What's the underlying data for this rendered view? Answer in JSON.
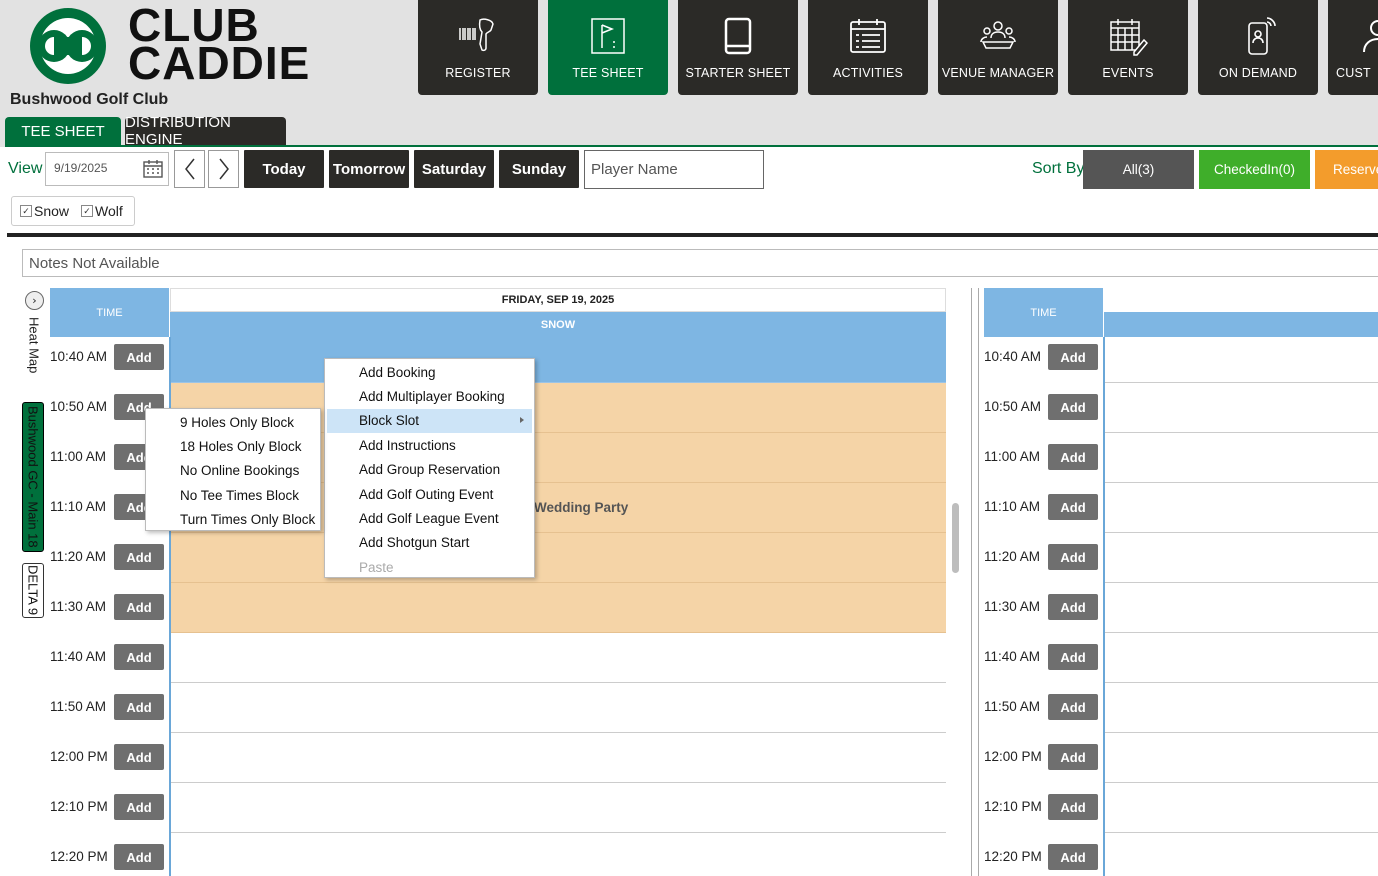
{
  "brand": {
    "logo_line1": "CLUB",
    "logo_line2": "CADDIE",
    "club_name": "Bushwood Golf Club",
    "primary_color": "#00703c",
    "dark_color": "#2b2a27"
  },
  "nav": [
    {
      "label": "REGISTER",
      "icon": "barcode-scanner-icon"
    },
    {
      "label": "TEE SHEET",
      "icon": "flag-icon",
      "active": true
    },
    {
      "label": "STARTER SHEET",
      "icon": "tablet-icon"
    },
    {
      "label": "ACTIVITIES",
      "icon": "calendar-list-icon"
    },
    {
      "label": "VENUE MANAGER",
      "icon": "group-table-icon"
    },
    {
      "label": "EVENTS",
      "icon": "calendar-edit-icon"
    },
    {
      "label": "ON DEMAND",
      "icon": "mobile-order-icon"
    },
    {
      "label": "CUST",
      "icon": "person-icon"
    }
  ],
  "subtabs": {
    "tee_sheet": "TEE SHEET",
    "distribution": "DISTRIBUTION ENGINE"
  },
  "toolbar": {
    "view_label": "View",
    "date_value": "9/19/2025",
    "quick_days": [
      "Today",
      "Tomorrow",
      "Saturday",
      "Sunday"
    ],
    "player_placeholder": "Player Name",
    "sort_label": "Sort By",
    "sort_buttons": [
      {
        "label": "All(3)",
        "color": "#555555"
      },
      {
        "label": "CheckedIn(0)",
        "color": "#3fae2a"
      },
      {
        "label": "Reserve",
        "color": "#f39c2c"
      }
    ]
  },
  "courses_filter": [
    {
      "label": "Snow",
      "checked": true
    },
    {
      "label": "Wolf",
      "checked": true
    }
  ],
  "notes": "Notes Not Available",
  "side_tabs": {
    "heat_map": "Heat Map",
    "course_main": "Bushwood GC - Main 18",
    "course_delta": "DELTA 9"
  },
  "sheet": {
    "time_header": "TIME",
    "day_title": "FRIDAY, SEP 19, 2025",
    "course_snow": "SNOW",
    "add_label": "Add",
    "block_label": "Wedding Party",
    "times": [
      "10:40 AM",
      "10:50 AM",
      "11:00 AM",
      "11:10 AM",
      "11:20 AM",
      "11:30 AM",
      "11:40 AM",
      "11:50 AM",
      "12:00 PM",
      "12:10 PM",
      "12:20 PM"
    ],
    "booked_color": "#7eb6e3",
    "block_color": "#f5d4a7"
  },
  "context_menu": {
    "items": [
      "Add Booking",
      "Add Multiplayer Booking",
      "Block Slot",
      "Add Instructions",
      "Add Group Reservation",
      "Add Golf Outing Event",
      "Add Golf League Event",
      "Add Shotgun Start",
      "Paste"
    ],
    "submenu": [
      "9 Holes Only Block",
      "18 Holes Only Block",
      "No Online Bookings",
      "No Tee Times Block",
      "Turn Times Only Block"
    ]
  }
}
